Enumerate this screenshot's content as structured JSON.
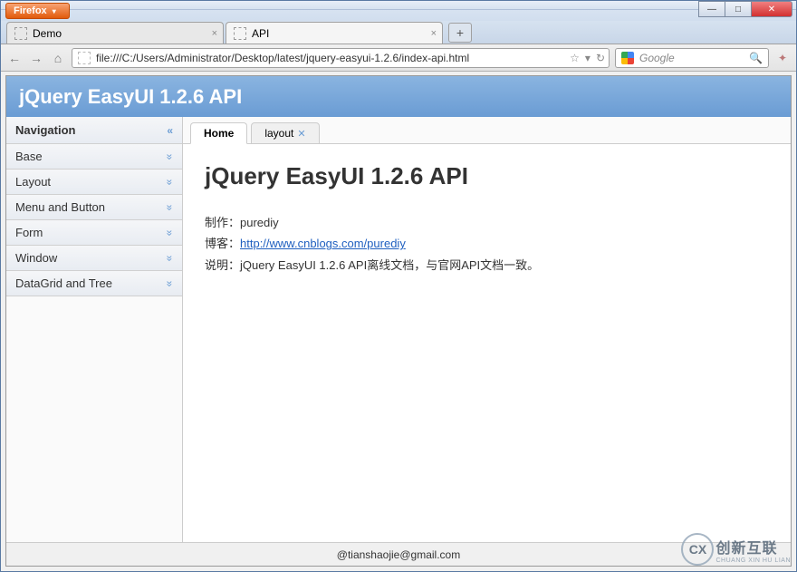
{
  "browser": {
    "app_button_label": "Firefox",
    "tabs": [
      {
        "title": "Demo",
        "active": false
      },
      {
        "title": "API",
        "active": true
      }
    ],
    "new_tab_symbol": "+",
    "nav": {
      "back": "←",
      "forward": "→",
      "home": "⌂"
    },
    "url": "file:///C:/Users/Administrator/Desktop/latest/jquery-easyui-1.2.6/index-api.html",
    "url_icons": {
      "star": "☆",
      "dropdown": "▾",
      "reload": "↻"
    },
    "search_placeholder": "Google",
    "window_controls": {
      "min": "—",
      "max": "□",
      "close": "✕"
    }
  },
  "page": {
    "header_title": "jQuery EasyUI 1.2.6 API",
    "sidebar": {
      "title": "Navigation",
      "items": [
        "Base",
        "Layout",
        "Menu and Button",
        "Form",
        "Window",
        "DataGrid and Tree"
      ]
    },
    "tabs": [
      {
        "label": "Home",
        "active": true,
        "closable": false
      },
      {
        "label": "layout",
        "active": false,
        "closable": true
      }
    ],
    "content": {
      "heading": "jQuery EasyUI 1.2.6 API",
      "line1_label": "制作：",
      "line1_value": "purediy",
      "line2_label": "博客：",
      "line2_link": "http://www.cnblogs.com/purediy",
      "line3_label": "说明：",
      "line3_value": "jQuery EasyUI 1.2.6 API离线文档，与官网API文档一致。"
    },
    "footer": "@tianshaojie@gmail.com"
  },
  "watermark": {
    "logo": "CX",
    "text": "创新互联",
    "sub": "CHUANG XIN HU LIAN"
  }
}
